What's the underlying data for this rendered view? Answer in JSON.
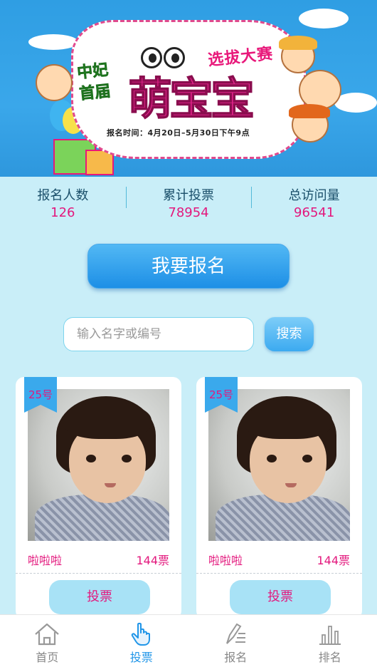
{
  "banner": {
    "title_small": "选拔大赛",
    "title_left_line1": "中妃",
    "title_left_line2": "首届",
    "title_big": "萌宝宝",
    "reg_time": "报名时间：4月20日–5月30日下午9点"
  },
  "stats": [
    {
      "label": "报名人数",
      "value": "126"
    },
    {
      "label": "累计投票",
      "value": "78954"
    },
    {
      "label": "总访问量",
      "value": "96541"
    }
  ],
  "register_label": "我要报名",
  "search": {
    "placeholder": "输入名字或编号",
    "button_label": "搜索"
  },
  "cards": [
    {
      "badge": "25号",
      "name": "啦啦啦",
      "votes": "144票",
      "vote_label": "投票"
    },
    {
      "badge": "25号",
      "name": "啦啦啦",
      "votes": "144票",
      "vote_label": "投票"
    }
  ],
  "nav": [
    {
      "label": "首页",
      "icon": "home-icon"
    },
    {
      "label": "投票",
      "icon": "hand-pointer-icon"
    },
    {
      "label": "报名",
      "icon": "pen-list-icon"
    },
    {
      "label": "排名",
      "icon": "bar-chart-icon"
    }
  ],
  "active_nav": "投票",
  "colors": {
    "accent": "#e3187d",
    "primary": "#2196e8",
    "background": "#c9eef8"
  }
}
